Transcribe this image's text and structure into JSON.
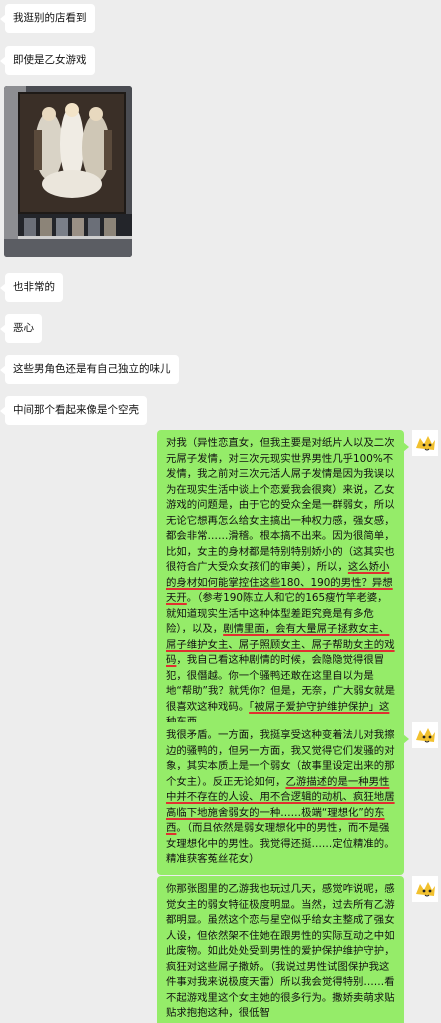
{
  "chat": {
    "incoming": [
      "我逛别的店看到",
      "即使是乙女游戏",
      "也非常的",
      "恶心",
      "这些男角色还是有自己独立的味儿",
      "中间那个看起来像是个空壳"
    ],
    "outgoing1": {
      "part1": "对我（异性恋直女，但我主要是对纸片人以及二次元屌子发情，对三次元现实世界男性几乎100%不发情，我之前对三次元活人屌子发情是因为我误以为在现实生活中谈上个恋爱我会很爽）来说，乙女游戏的问题是，由于它的受众全是一群弱女，所以无论它想再怎么给女主搞出一种权力感，强女感，都会非常……滑稽。根本搞不出来。因为很简单，比如，女主的身材都是特别特别娇小的（这其实也很符合广大受众女孩们的审美），所以，",
      "hl1": "这么娇小的身材如何能掌控住这些180、190的男性？异想天开",
      "part2": "。（参考190陈立人和它的165瘦竹竿老婆，就知道现实生活中这种体型差距究竟是有多危险）",
      "part3": "，以及，",
      "hl2": "剧情里面，会有大量屌子拯救女主、屌子维护女主、屌子照顾女主、屌子帮助女主的戏码",
      "part4": "，我自己看这种剧情的时候，会隐隐觉得很冒犯，很僭越。你一个骚鸭还敢在这里自以为是地“帮助”我？就凭你？但是，无奈，广大弱女就是很喜欢这种戏码。",
      "hl3": "「被屌子爱护守护维护保护」这种东西",
      "part5": "。"
    },
    "outgoing2": {
      "part1": "我很矛盾。一方面，我挺享受这种变着法儿对我擦边的骚鸭的，但另一方面，我又觉得它们发骚的对象，其实本质上是一个弱女（故事里设定出来的那个女主）。反正无论如何，",
      "hl1": "乙游描述的是一种男性中并不存在的人设、用不合逻辑的动机、疯狂地居高临下地施舍弱女的一种……极端“理想化”的东西",
      "part2": "。（而且依然是弱女理想化中的男性，而不是强女理想化中的男性。我觉得还挺……定位精准的。精准获客菟丝花女）"
    },
    "outgoing3": "你那张图里的乙游我也玩过几天，感觉咋说呢，感觉女主的弱女特征极度明显。当然，过去所有乙游都明显。虽然这个恋与星空似乎给女主整成了强女人设，但依然架不住她在跟男性的实际互动之中如此废物。如此处处受到男性的爱护保护维护守护，疯狂对这些屌子撒娇。（我说过男性试图保护我这件事对我来说极度天雷）所以我会觉得特别……看不起游戏里这个女主她的很多行为。撒娇卖萌求贴贴求抱抱这种，很低智"
  },
  "colors": {
    "background": "#ededed",
    "incoming_bubble": "#ffffff",
    "outgoing_bubble": "#95ec69",
    "highlight_underline": "#e03030"
  },
  "icons": {
    "avatar": "cartoon-dog-avatar-icon",
    "photo": "otome-game-poster-photo"
  }
}
